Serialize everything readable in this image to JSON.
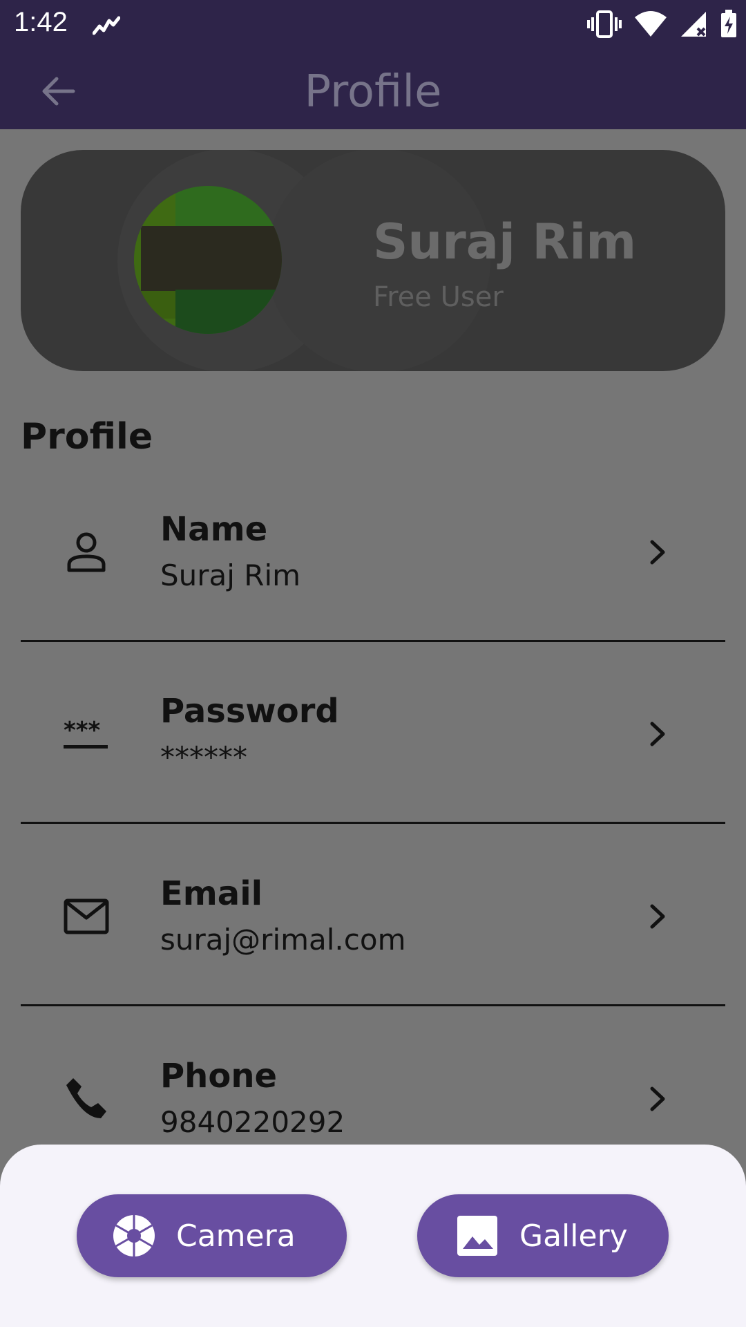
{
  "status_bar": {
    "time": "1:42",
    "icons": [
      "notification-icon",
      "vibrate-icon",
      "wifi-icon",
      "signal-icon",
      "battery-icon"
    ]
  },
  "app_bar": {
    "title": "Profile",
    "back_icon": "arrow-back-icon"
  },
  "header": {
    "name": "Suraj Rim",
    "subtitle": "Free User"
  },
  "section": {
    "title": "Profile"
  },
  "rows": [
    {
      "icon": "person-icon",
      "label": "Name",
      "value": "Suraj Rim"
    },
    {
      "icon": "password-icon",
      "label": "Password",
      "value": "******"
    },
    {
      "icon": "mail-icon",
      "label": "Email",
      "value": "suraj@rimal.com"
    },
    {
      "icon": "phone-icon",
      "label": "Phone",
      "value": "9840220292"
    }
  ],
  "bottom_sheet": {
    "camera_label": "Camera",
    "gallery_label": "Gallery"
  },
  "colors": {
    "app_bar": "#2e2449",
    "button": "#684ea1",
    "sheet": "#f5f3fa",
    "scrim_background": "#767676"
  }
}
